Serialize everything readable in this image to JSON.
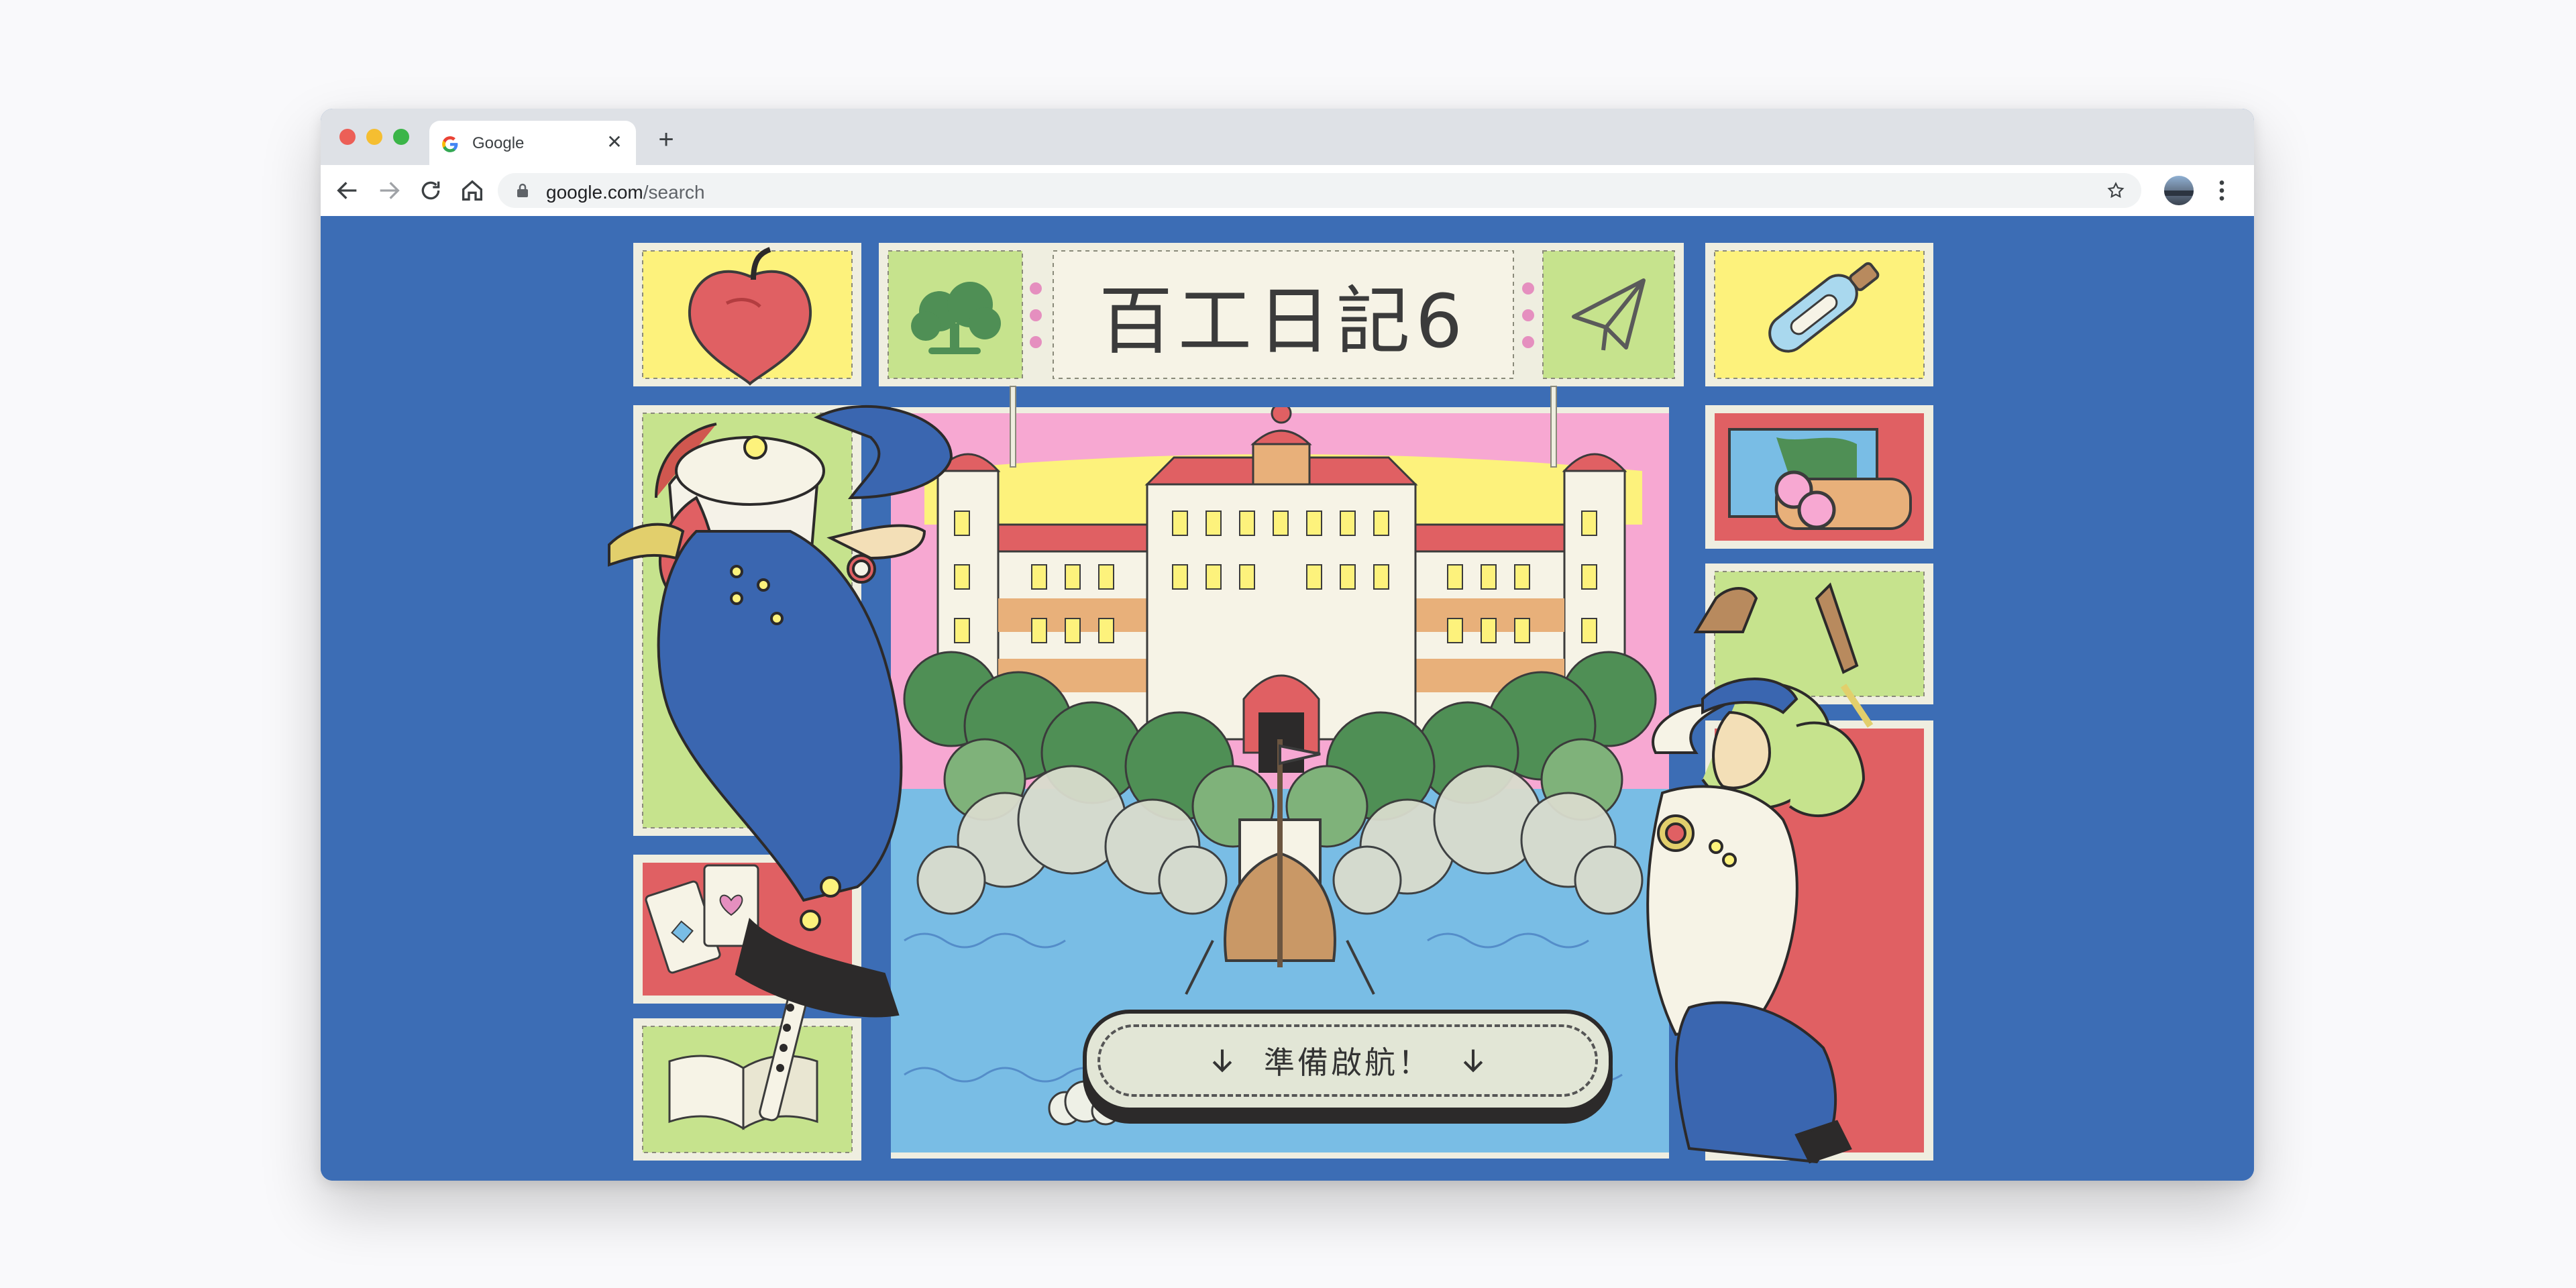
{
  "browser": {
    "tab": {
      "title": "Google",
      "close_glyph": "✕"
    },
    "new_tab_glyph": "+",
    "address": {
      "host": "google.com",
      "path": "/search"
    },
    "traffic_lights": {
      "close": "#ec5f57",
      "minimize": "#f5be31",
      "maximize": "#3bb548"
    }
  },
  "doodle": {
    "title_text": "百工日記6",
    "cta_label": "準備啟航！",
    "colors": {
      "background": "#3c6db5",
      "panel_frame": "#efeee0",
      "yellow": "#fdf27c",
      "green": "#c6e38d",
      "red": "#e06063",
      "pink": "#f7a8d2",
      "water": "#79bde5"
    }
  },
  "icons": [
    "google-favicon-icon",
    "back-arrow-icon",
    "forward-arrow-icon",
    "reload-icon",
    "home-icon",
    "lock-icon",
    "star-icon",
    "profile-avatar-icon",
    "menu-dots-icon"
  ]
}
